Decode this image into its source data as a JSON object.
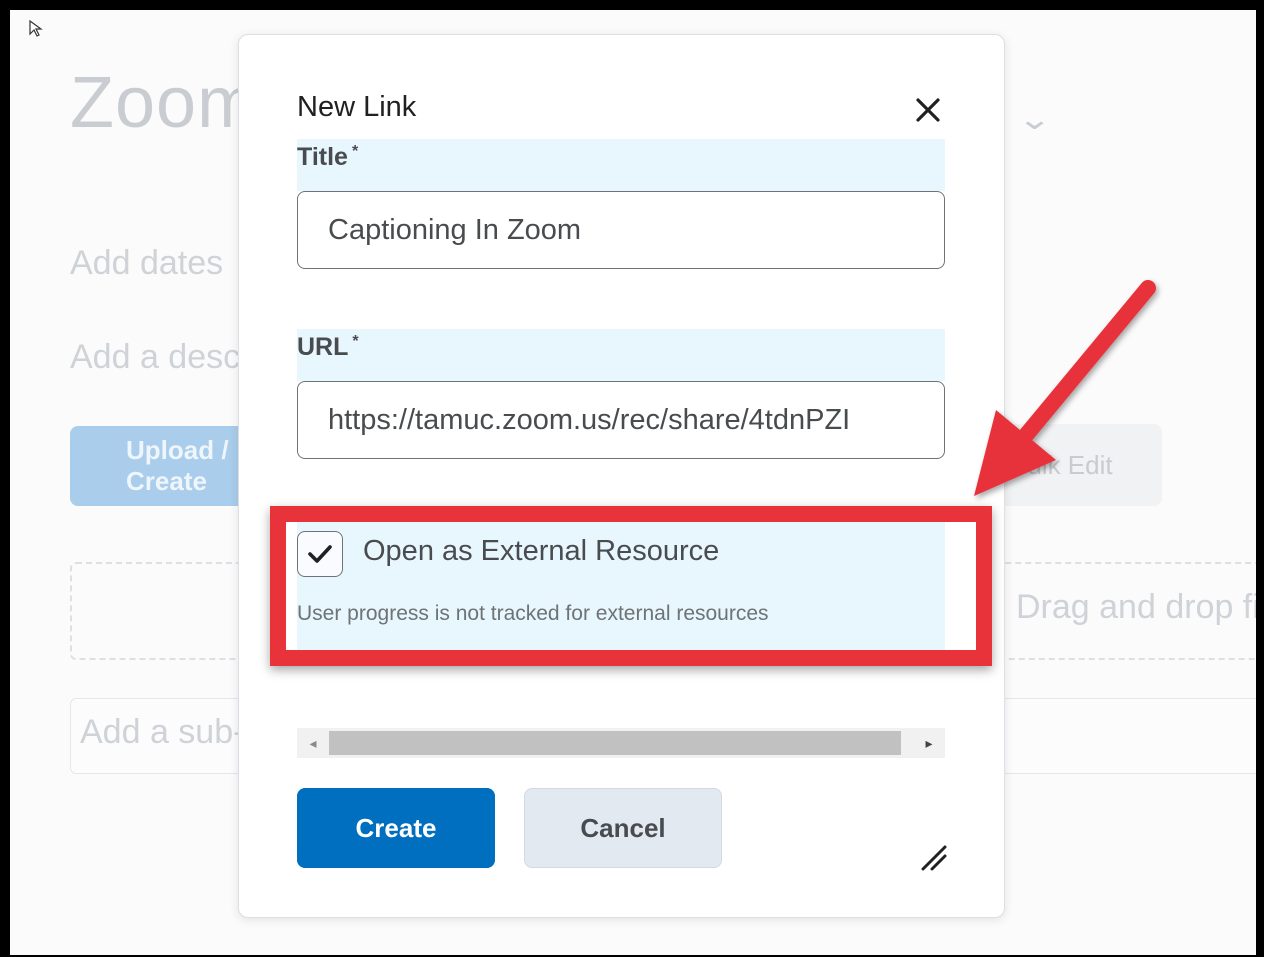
{
  "background": {
    "title": "Zoom",
    "add_dates": "Add dates",
    "add_description": "Add a description",
    "upload_button": "Upload / Create",
    "bulk_edit_button": "Bulk Edit",
    "dashed_text": "Drag and drop files here to create and update topics",
    "add_subsection": "Add a sub-module"
  },
  "dialog": {
    "title": "New Link",
    "title_field": {
      "label": "Title",
      "required_marker": "*",
      "value": "Captioning In Zoom"
    },
    "url_field": {
      "label": "URL",
      "required_marker": "*",
      "value": "https://tamuc.zoom.us/rec/share/4tdnPZI"
    },
    "external": {
      "checked": true,
      "label": "Open as External Resource",
      "help": "User progress is not tracked for external resources"
    },
    "buttons": {
      "create": "Create",
      "cancel": "Cancel"
    }
  },
  "colors": {
    "primary": "#006fbf",
    "highlight": "#e8333b",
    "field_bg": "#e8f6fd"
  },
  "icons": [
    "close-icon",
    "checkmark-icon",
    "scroll-left-arrow-icon",
    "scroll-right-arrow-icon",
    "resize-handle-icon",
    "chevron-down-icon",
    "mouse-cursor-icon"
  ]
}
